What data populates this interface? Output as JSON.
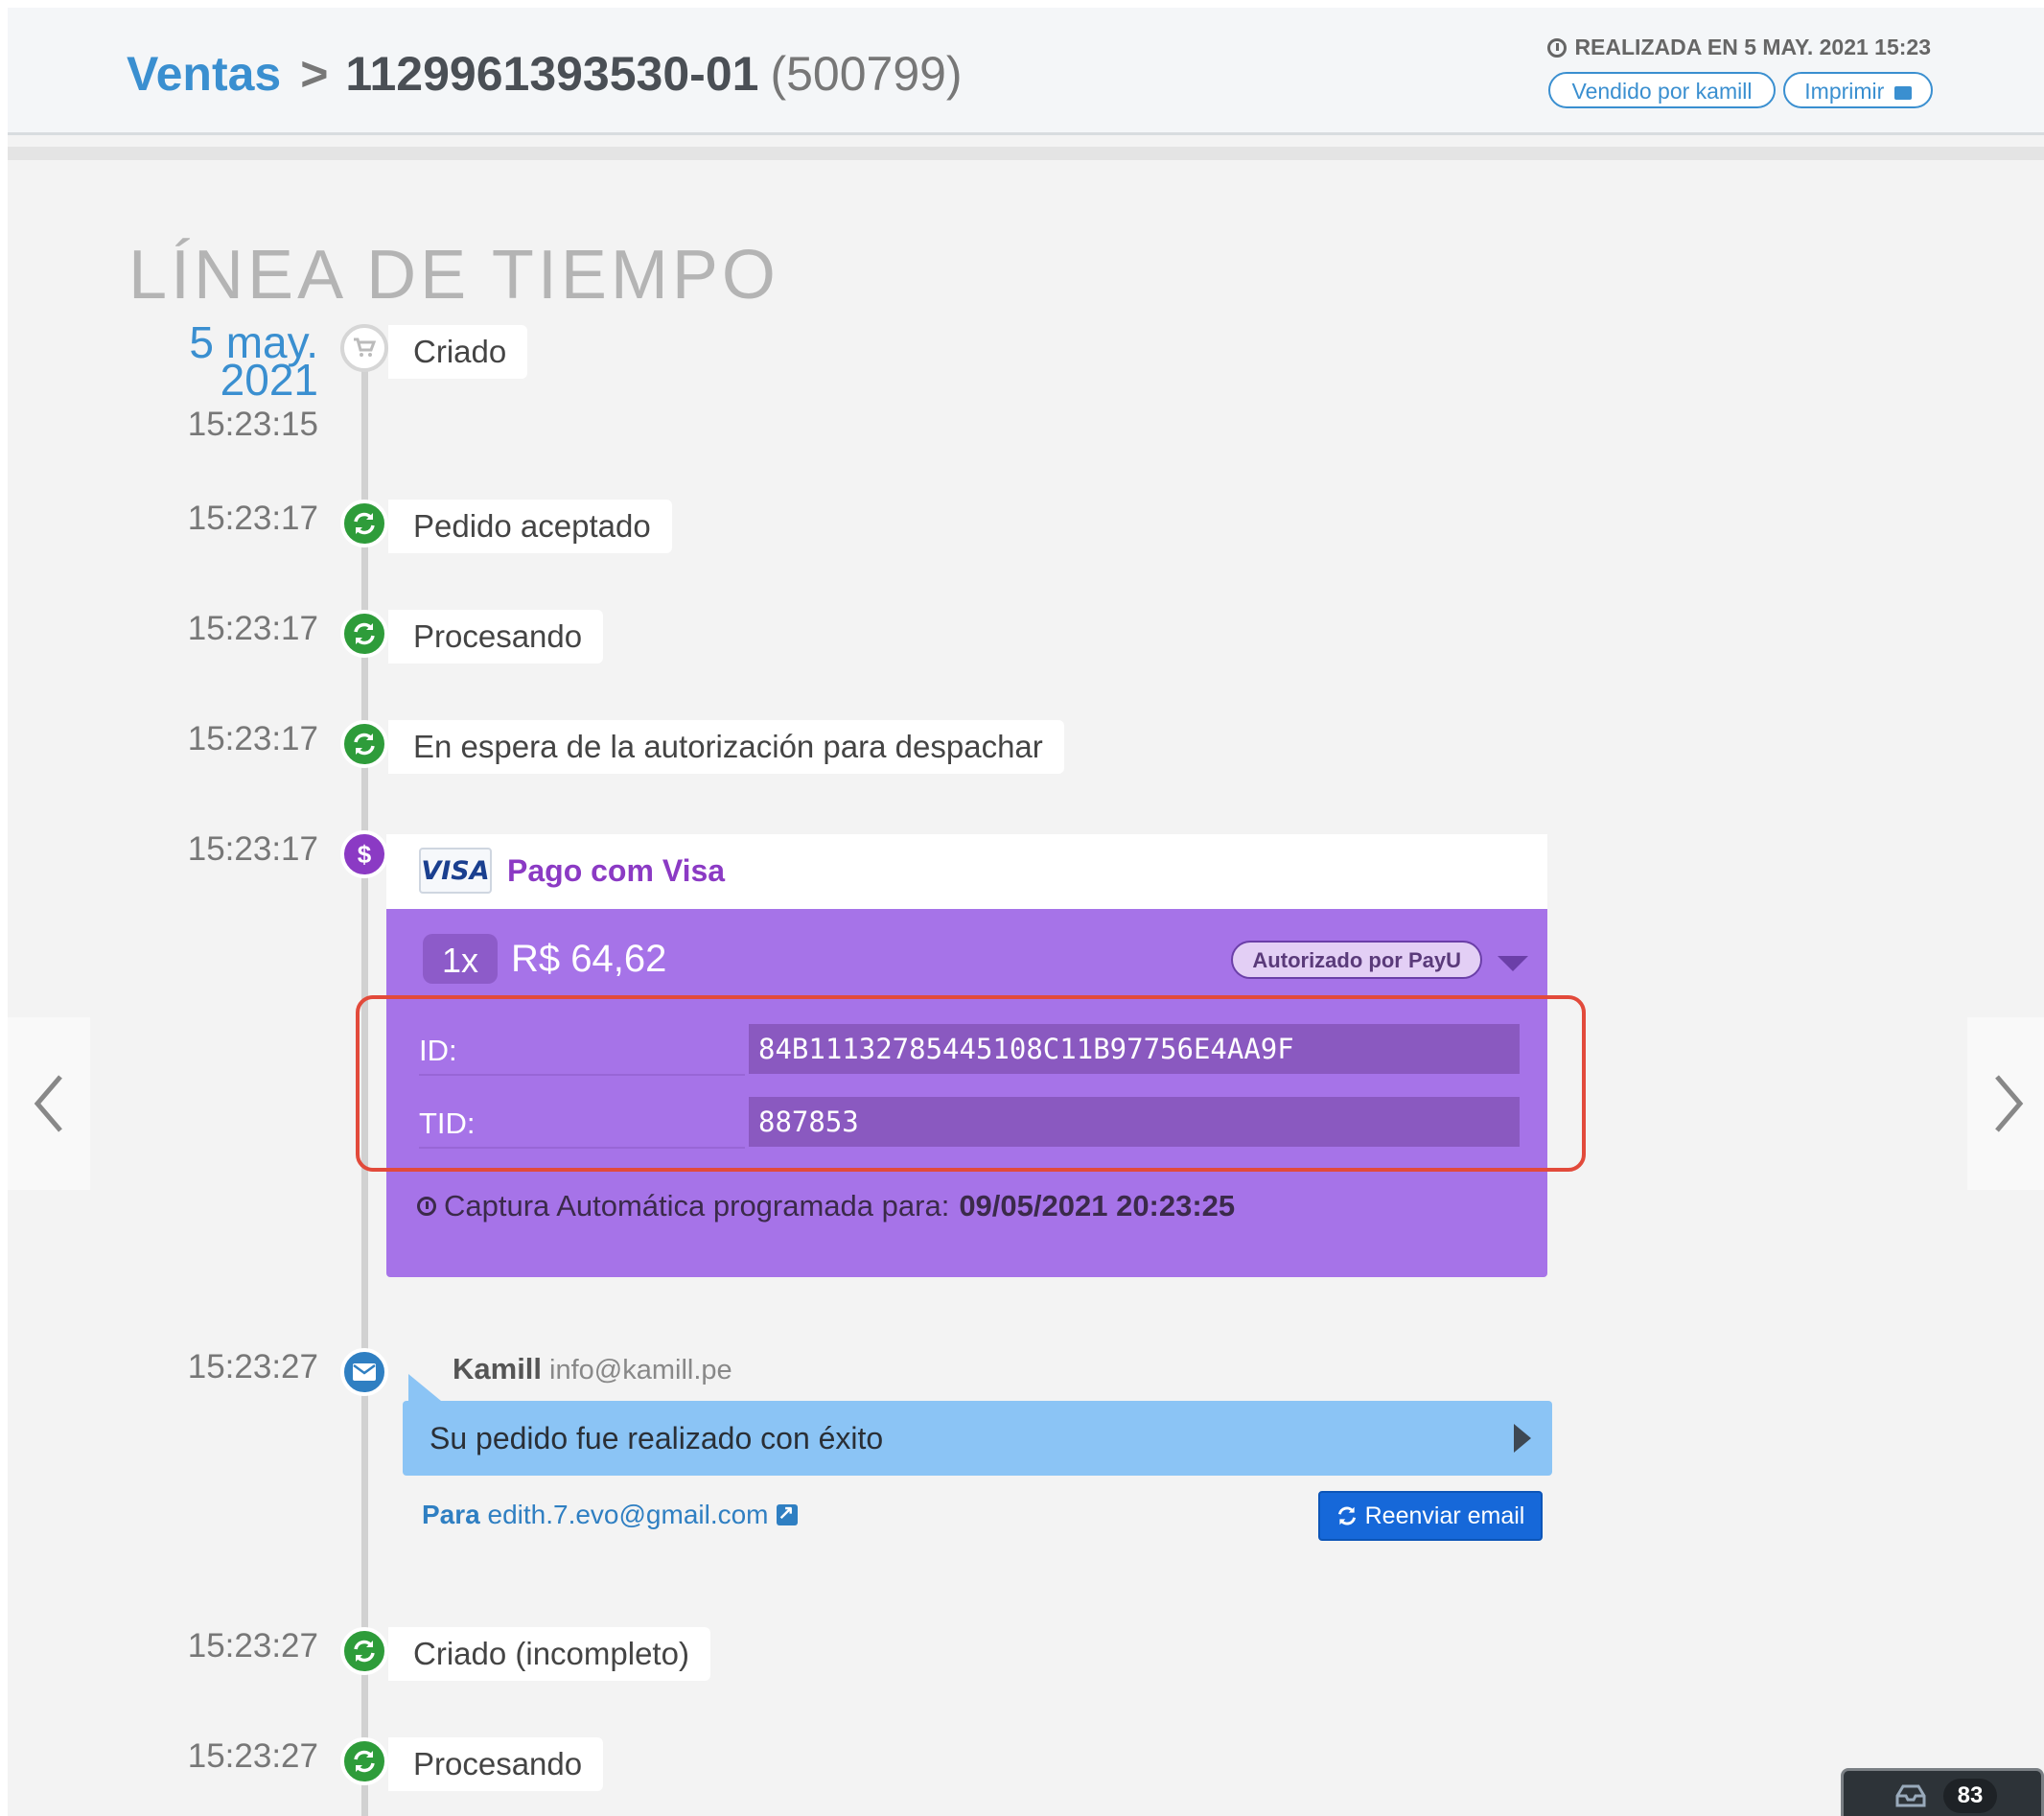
{
  "header": {
    "breadcrumb_root": "Ventas",
    "order_id": "1129961393530-01",
    "order_number": "(500799)",
    "created_at": "REALIZADA EN 5 MAY. 2021 15:23",
    "sold_by": "Vendido por kamill",
    "print": "Imprimir"
  },
  "timeline": {
    "title": "LÍNEA DE TIEMPO",
    "date_day": "5 may.",
    "date_year": "2021",
    "events": [
      {
        "time": "15:23:15",
        "label": "Criado",
        "icon": "cart-icon"
      },
      {
        "time": "15:23:17",
        "label": "Pedido aceptado",
        "icon": "sync-icon"
      },
      {
        "time": "15:23:17",
        "label": "Procesando",
        "icon": "sync-icon"
      },
      {
        "time": "15:23:17",
        "label": "En espera de la autorización para despachar",
        "icon": "sync-icon"
      },
      {
        "time": "15:23:17",
        "label": "Pago com Visa",
        "icon": "dollar-icon"
      },
      {
        "time": "15:23:27",
        "label": "Email",
        "icon": "envelope-icon"
      },
      {
        "time": "15:23:27",
        "label": "Criado (incompleto)",
        "icon": "sync-icon"
      },
      {
        "time": "15:23:27",
        "label": "Procesando",
        "icon": "sync-icon"
      }
    ]
  },
  "payment": {
    "card_brand": "VISA",
    "title": "Pago com Visa",
    "installments": "1x",
    "amount": "R$ 64,62",
    "status": "Autorizado por PayU",
    "id_label": "ID:",
    "id_value": "84B11132785445108C11B97756E4AA9F",
    "tid_label": "TID:",
    "tid_value": "887853",
    "capture_text": "Captura Automática programada para:",
    "capture_date": "09/05/2021 20:23:25",
    "color": "#a673e8"
  },
  "email": {
    "sender_name": "Kamill",
    "sender_email": "info@kamill.pe",
    "subject": "Su pedido fue realizado con éxito",
    "to_label": "Para",
    "to_email": "edith.7.evo@gmail.com",
    "resend": "Reenviar email"
  },
  "chat": {
    "count": "83"
  },
  "colors": {
    "accent": "#3a8fd0",
    "success": "#2e9c3a",
    "payment": "#8b3ac4",
    "highlight": "#e24a3b"
  }
}
